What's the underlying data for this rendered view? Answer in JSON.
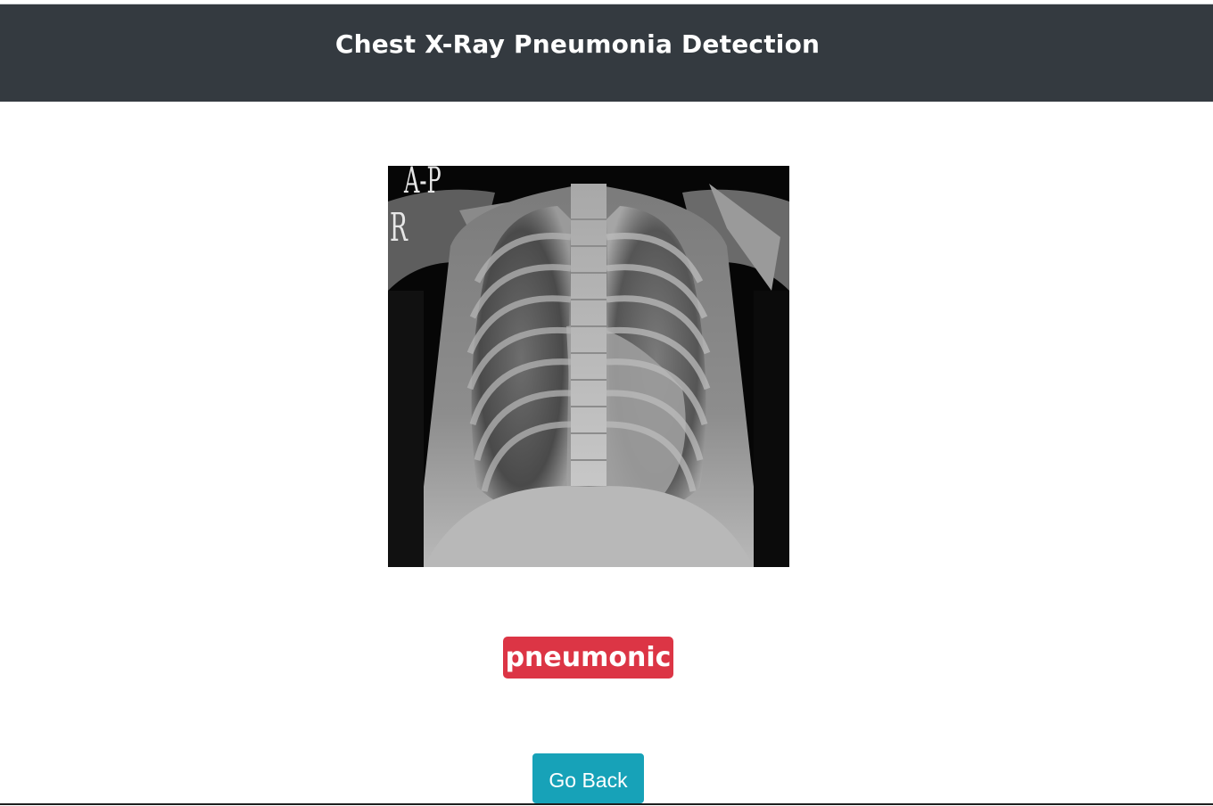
{
  "header": {
    "title": "Chest X-Ray Pneumonia Detection"
  },
  "xray_image": {
    "markers": {
      "projection": "A-P",
      "side": "R"
    }
  },
  "result": {
    "label": "pneumonic",
    "color": "#dc3545"
  },
  "actions": {
    "back_label": "Go Back",
    "color": "#17a2b8"
  },
  "colors": {
    "header_bg": "#343a40"
  }
}
